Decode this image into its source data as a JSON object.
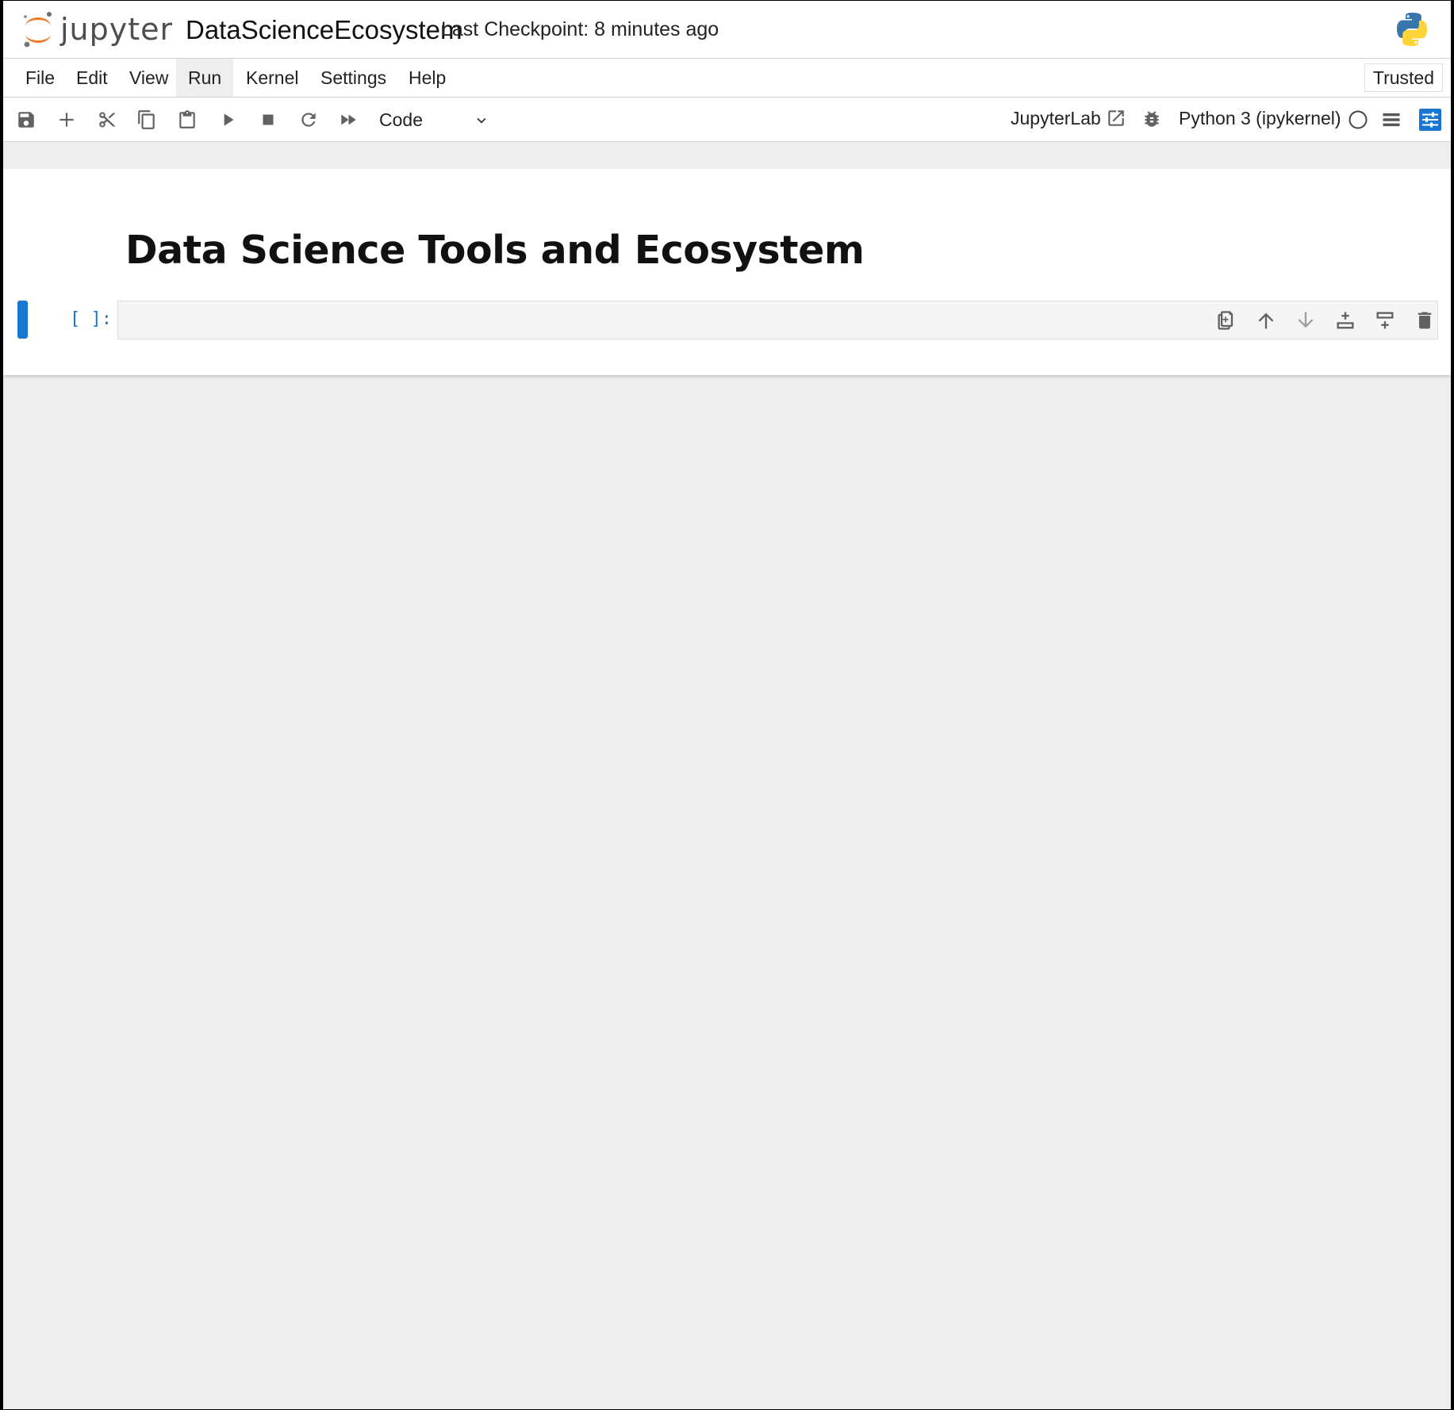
{
  "header": {
    "logo_text": "jupyter",
    "notebook_name": "DataScienceEcosystem",
    "checkpoint": "Last Checkpoint: 8 minutes ago"
  },
  "menubar": {
    "items": [
      {
        "label": "File"
      },
      {
        "label": "Edit"
      },
      {
        "label": "View"
      },
      {
        "label": "Run"
      },
      {
        "label": "Kernel"
      },
      {
        "label": "Settings"
      },
      {
        "label": "Help"
      }
    ],
    "active": "Run",
    "trusted": "Trusted"
  },
  "toolbar": {
    "cell_type": "Code",
    "jupyterlab_link": "JupyterLab",
    "kernel_name": "Python 3 (ipykernel)",
    "icons": [
      "save-icon",
      "add-icon",
      "cut-icon",
      "copy-icon",
      "paste-icon",
      "run-icon",
      "stop-icon",
      "restart-icon",
      "fast-forward-icon"
    ]
  },
  "notebook": {
    "markdown_title": "Data Science Tools and Ecosystem",
    "code_cell": {
      "prompt": "[ ]:",
      "content": ""
    },
    "cell_tools": [
      "duplicate-icon",
      "move-up-icon",
      "move-down-icon",
      "insert-below-icon",
      "insert-above-icon",
      "delete-icon"
    ]
  },
  "colors": {
    "accent": "#1976d2",
    "jupyter_orange": "#f37726",
    "background": "#eeeeee"
  }
}
